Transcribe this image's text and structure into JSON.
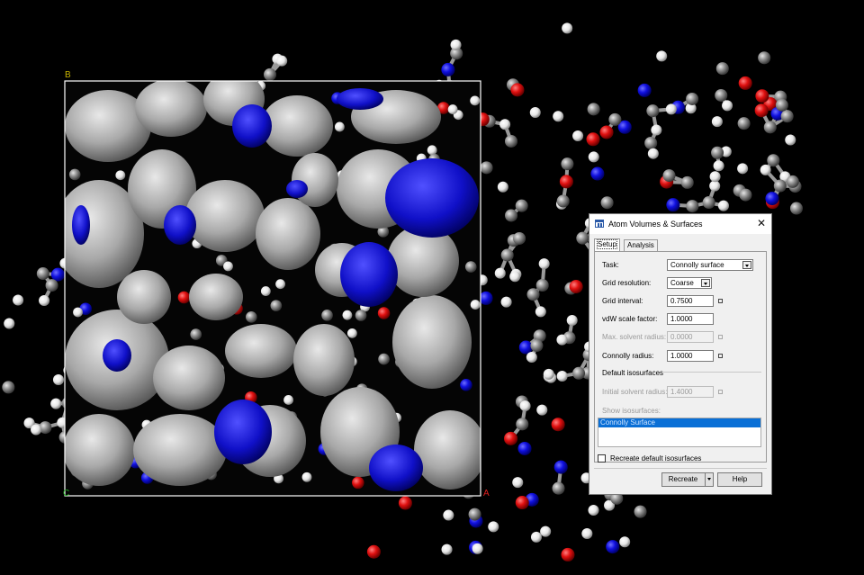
{
  "colors": {
    "carbon": "#8c8c8c",
    "hydrogen": "#eeeeee",
    "oxygen": "#e01010",
    "nitrogen": "#1010e0",
    "surface": "#b4b4b4",
    "surface_blue": "#1a1ad0",
    "box": "#ffffff",
    "label_b": "#c8b400",
    "label_c": "#20b020"
  },
  "scene": {
    "label_b": "B",
    "label_c": "C",
    "label_a": "A"
  },
  "dialog": {
    "title": "Atom Volumes & Surfaces",
    "tabs": [
      "Setup",
      "Analysis"
    ],
    "task_label": "Task:",
    "task_value": "Connolly surface",
    "grid_res_label": "Grid resolution:",
    "grid_res_value": "Coarse",
    "grid_interval_label": "Grid interval:",
    "grid_interval_value": "0.7500",
    "vdw_label": "vdW scale factor:",
    "vdw_value": "1.0000",
    "max_solvent_label": "Max. solvent radius:",
    "max_solvent_value": "0.0000",
    "connolly_label": "Connolly radius:",
    "connolly_value": "1.0000",
    "default_iso_header": "Default isosurfaces",
    "initial_solvent_label": "Initial solvent radius:",
    "initial_solvent_value": "1.4000",
    "show_iso_label": "Show isosurfaces:",
    "iso_items": [
      "Connolly Surface"
    ],
    "recreate_default_label": "Recreate default isosurfaces",
    "recreate_button": "Recreate",
    "help_button": "Help"
  }
}
